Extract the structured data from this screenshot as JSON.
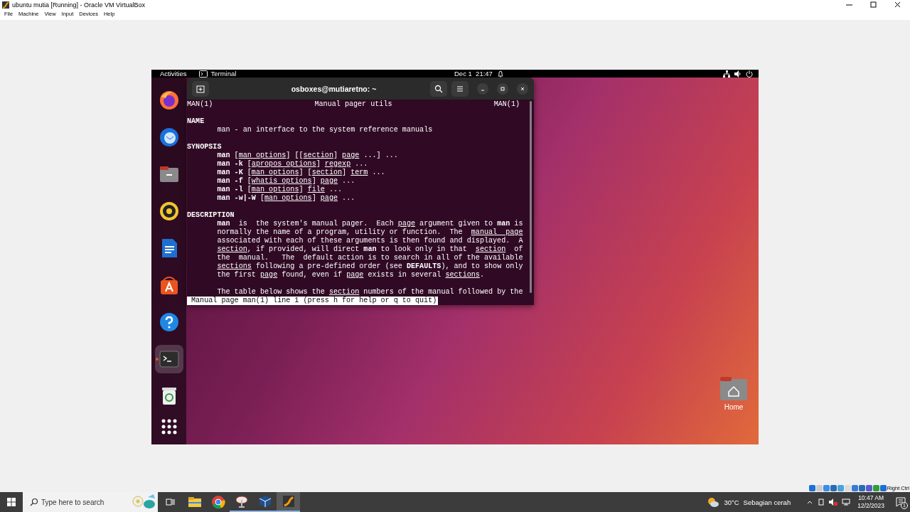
{
  "host_window": {
    "title": "ubuntu mutia [Running] - Oracle VM VirtualBox",
    "menu": [
      "File",
      "Machine",
      "View",
      "Input",
      "Devices",
      "Help"
    ]
  },
  "top_bar": {
    "activities": "Activities",
    "app": "Terminal",
    "clock": "Dec 1  21:47"
  },
  "dock": {
    "items": [
      {
        "kind": "firefox",
        "selected": false
      },
      {
        "kind": "thunderbird",
        "selected": false
      },
      {
        "kind": "files",
        "selected": false
      },
      {
        "kind": "rhythmbox",
        "selected": false
      },
      {
        "kind": "writer",
        "selected": false
      },
      {
        "kind": "software",
        "selected": false
      },
      {
        "kind": "help",
        "selected": false
      },
      {
        "kind": "terminal",
        "selected": true
      },
      {
        "kind": "trash",
        "selected": false
      }
    ]
  },
  "terminal": {
    "title": "osboxes@mutiaretno: ~",
    "header": {
      "left": "MAN(1)",
      "center": "Manual pager utils",
      "right": "MAN(1)"
    },
    "lines": [
      {
        "kind": "blank"
      },
      {
        "kind": "heading",
        "text": "NAME"
      },
      {
        "kind": "body",
        "segments": [
          {
            "bold": false,
            "underline": false,
            "t": "man - an interface to the system reference manuals"
          }
        ]
      },
      {
        "kind": "blank"
      },
      {
        "kind": "heading",
        "text": "SYNOPSIS"
      },
      {
        "kind": "body",
        "segments": [
          {
            "bold": true,
            "underline": false,
            "t": "man"
          },
          {
            "bold": false,
            "underline": false,
            "t": " ["
          },
          {
            "bold": false,
            "underline": true,
            "t": "man options"
          },
          {
            "bold": false,
            "underline": false,
            "t": "] [["
          },
          {
            "bold": false,
            "underline": true,
            "t": "section"
          },
          {
            "bold": false,
            "underline": false,
            "t": "] "
          },
          {
            "bold": false,
            "underline": true,
            "t": "page"
          },
          {
            "bold": false,
            "underline": false,
            "t": " ...] ..."
          }
        ]
      },
      {
        "kind": "body",
        "segments": [
          {
            "bold": true,
            "underline": false,
            "t": "man -k"
          },
          {
            "bold": false,
            "underline": false,
            "t": " ["
          },
          {
            "bold": false,
            "underline": true,
            "t": "apropos options"
          },
          {
            "bold": false,
            "underline": false,
            "t": "] "
          },
          {
            "bold": false,
            "underline": true,
            "t": "regexp"
          },
          {
            "bold": false,
            "underline": false,
            "t": " ..."
          }
        ]
      },
      {
        "kind": "body",
        "segments": [
          {
            "bold": true,
            "underline": false,
            "t": "man -K"
          },
          {
            "bold": false,
            "underline": false,
            "t": " ["
          },
          {
            "bold": false,
            "underline": true,
            "t": "man options"
          },
          {
            "bold": false,
            "underline": false,
            "t": "] ["
          },
          {
            "bold": false,
            "underline": true,
            "t": "section"
          },
          {
            "bold": false,
            "underline": false,
            "t": "] "
          },
          {
            "bold": false,
            "underline": true,
            "t": "term"
          },
          {
            "bold": false,
            "underline": false,
            "t": " ..."
          }
        ]
      },
      {
        "kind": "body",
        "segments": [
          {
            "bold": true,
            "underline": false,
            "t": "man -f"
          },
          {
            "bold": false,
            "underline": false,
            "t": " ["
          },
          {
            "bold": false,
            "underline": true,
            "t": "whatis options"
          },
          {
            "bold": false,
            "underline": false,
            "t": "] "
          },
          {
            "bold": false,
            "underline": true,
            "t": "page"
          },
          {
            "bold": false,
            "underline": false,
            "t": " ..."
          }
        ]
      },
      {
        "kind": "body",
        "segments": [
          {
            "bold": true,
            "underline": false,
            "t": "man -l"
          },
          {
            "bold": false,
            "underline": false,
            "t": " ["
          },
          {
            "bold": false,
            "underline": true,
            "t": "man options"
          },
          {
            "bold": false,
            "underline": false,
            "t": "] "
          },
          {
            "bold": false,
            "underline": true,
            "t": "file"
          },
          {
            "bold": false,
            "underline": false,
            "t": " ..."
          }
        ]
      },
      {
        "kind": "body",
        "segments": [
          {
            "bold": true,
            "underline": false,
            "t": "man -w|-W"
          },
          {
            "bold": false,
            "underline": false,
            "t": " ["
          },
          {
            "bold": false,
            "underline": true,
            "t": "man options"
          },
          {
            "bold": false,
            "underline": false,
            "t": "] "
          },
          {
            "bold": false,
            "underline": true,
            "t": "page"
          },
          {
            "bold": false,
            "underline": false,
            "t": " ..."
          }
        ]
      },
      {
        "kind": "blank"
      },
      {
        "kind": "heading",
        "text": "DESCRIPTION"
      },
      {
        "kind": "body",
        "segments": [
          {
            "bold": true,
            "underline": false,
            "t": "man"
          },
          {
            "bold": false,
            "underline": false,
            "t": "  is  the system's manual pager.  Each "
          },
          {
            "bold": false,
            "underline": true,
            "t": "page"
          },
          {
            "bold": false,
            "underline": false,
            "t": " argument given to "
          },
          {
            "bold": true,
            "underline": false,
            "t": "man"
          },
          {
            "bold": false,
            "underline": false,
            "t": " is"
          }
        ]
      },
      {
        "kind": "body",
        "segments": [
          {
            "bold": false,
            "underline": false,
            "t": "normally the name of a program, utility or function.  The  "
          },
          {
            "bold": false,
            "underline": true,
            "t": "manual  page"
          }
        ]
      },
      {
        "kind": "body",
        "segments": [
          {
            "bold": false,
            "underline": false,
            "t": "associated with each of these arguments is then found and displayed.  A"
          }
        ]
      },
      {
        "kind": "body",
        "segments": [
          {
            "bold": false,
            "underline": true,
            "t": "section"
          },
          {
            "bold": false,
            "underline": false,
            "t": ", if provided, will direct "
          },
          {
            "bold": true,
            "underline": false,
            "t": "man"
          },
          {
            "bold": false,
            "underline": false,
            "t": " to look only in that  "
          },
          {
            "bold": false,
            "underline": true,
            "t": "section"
          },
          {
            "bold": false,
            "underline": false,
            "t": "  of"
          }
        ]
      },
      {
        "kind": "body",
        "segments": [
          {
            "bold": false,
            "underline": false,
            "t": "the  manual.   The  default action is to search in all of the available"
          }
        ]
      },
      {
        "kind": "body",
        "segments": [
          {
            "bold": false,
            "underline": true,
            "t": "sections"
          },
          {
            "bold": false,
            "underline": false,
            "t": " following a pre-defined order (see "
          },
          {
            "bold": true,
            "underline": false,
            "t": "DEFAULTS"
          },
          {
            "bold": false,
            "underline": false,
            "t": "), and to show only"
          }
        ]
      },
      {
        "kind": "body",
        "segments": [
          {
            "bold": false,
            "underline": false,
            "t": "the first "
          },
          {
            "bold": false,
            "underline": true,
            "t": "page"
          },
          {
            "bold": false,
            "underline": false,
            "t": " found, even if "
          },
          {
            "bold": false,
            "underline": true,
            "t": "page"
          },
          {
            "bold": false,
            "underline": false,
            "t": " exists in several "
          },
          {
            "bold": false,
            "underline": true,
            "t": "sections"
          },
          {
            "bold": false,
            "underline": false,
            "t": "."
          }
        ]
      },
      {
        "kind": "blank"
      },
      {
        "kind": "body",
        "segments": [
          {
            "bold": false,
            "underline": false,
            "t": "The table below shows the "
          },
          {
            "bold": false,
            "underline": true,
            "t": "section"
          },
          {
            "bold": false,
            "underline": false,
            "t": " numbers of the manual followed by the"
          }
        ]
      }
    ],
    "status": "Manual page man(1) line 1 (press h for help or q to quit)"
  },
  "desktop": {
    "home_label": "Home"
  },
  "vm_status": {
    "host_key": "Right Ctrl"
  },
  "taskbar": {
    "search_placeholder": "Type here to search",
    "apps": [
      {
        "kind": "explorer",
        "open": false,
        "selected": false
      },
      {
        "kind": "chrome",
        "open": false,
        "selected": false
      },
      {
        "kind": "satellite",
        "open": true,
        "selected": false
      },
      {
        "kind": "virtualbox",
        "open": true,
        "selected": false
      },
      {
        "kind": "vm",
        "open": true,
        "selected": true
      }
    ],
    "temperature": "30°C",
    "weather": "Sebagian cerah",
    "time": "10:47 AM",
    "date": "12/2/2023",
    "notifications": "1"
  }
}
